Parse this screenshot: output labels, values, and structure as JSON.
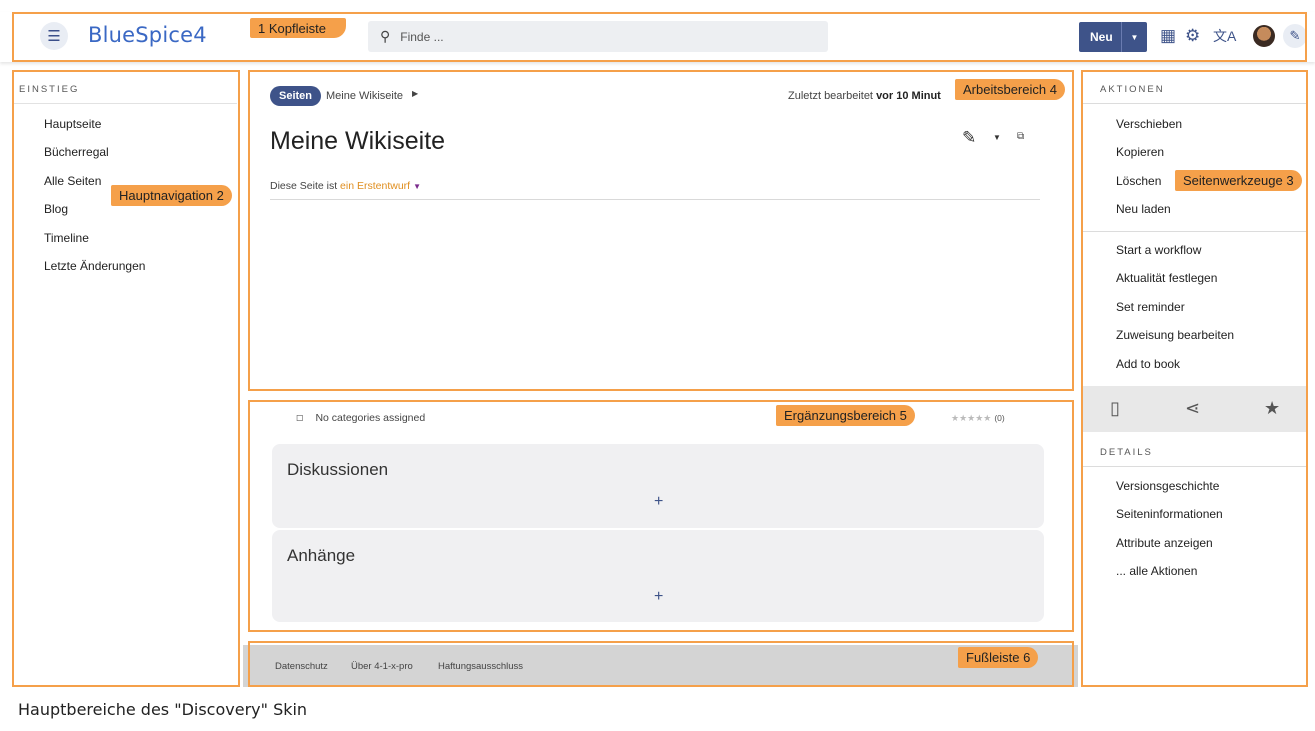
{
  "header": {
    "logo": "BlueSpice4",
    "search_placeholder": "Finde ...",
    "new_button": "Neu"
  },
  "left_nav": {
    "section_title": "EINSTIEG",
    "items": [
      "Hauptseite",
      "Bücherregal",
      "Alle Seiten",
      "Blog",
      "Timeline",
      "Letzte Änderungen"
    ]
  },
  "main": {
    "breadcrumb_pill": "Seiten",
    "breadcrumb_item": "Meine Wikiseite",
    "last_edited_prefix": "Zuletzt bearbeitet",
    "last_edited_value": "vor 10 Minut",
    "title": "Meine Wikiseite",
    "status_prefix": "Diese Seite ist",
    "status_value": "ein Erstentwurf"
  },
  "extension": {
    "categories": "No categories assigned",
    "rating_stars": "★★★★★",
    "rating_count": "(0)",
    "panels": [
      {
        "title": "Diskussionen",
        "add": "+"
      },
      {
        "title": "Anhänge",
        "add": "+"
      }
    ]
  },
  "footer": {
    "links": [
      "Datenschutz",
      "Über 4-1-x-pro",
      "Haftungsausschluss"
    ]
  },
  "right_sidebar": {
    "actions_title": "AKTIONEN",
    "actions": [
      "Verschieben",
      "Kopieren",
      "Löschen",
      "Neu laden"
    ],
    "workflow_items": [
      "Start a workflow",
      "Aktualität festlegen",
      "Set reminder",
      "Zuweisung bearbeiten",
      "Add to book"
    ],
    "details_title": "DETAILS",
    "details": [
      "Versionsgeschichte",
      "Seiteninformationen",
      "Attribute anzeigen",
      "... alle Aktionen"
    ]
  },
  "annotations": {
    "header": "1 Kopfleiste",
    "nav": "Hauptnavigation 2",
    "tools": "Seitenwerkzeuge 3",
    "content": "Arbeitsbereich 4",
    "extension": "Ergänzungsbereich 5",
    "footer": "Fußleiste 6",
    "color": "#f5a04a"
  },
  "caption": "Hauptbereiche des \"Discovery\" Skin",
  "colors": {
    "primary": "#3e5389",
    "logo": "#3a68c4",
    "draft": "#e08f20"
  }
}
